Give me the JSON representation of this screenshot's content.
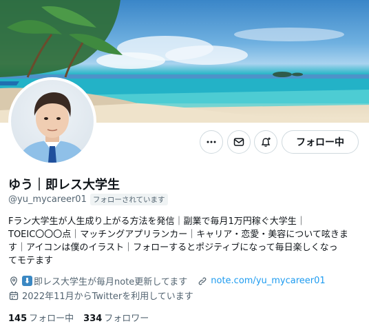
{
  "profile": {
    "display_name": "ゆう｜即レス大学生",
    "handle": "@yu_mycareer01",
    "follows_you_badge": "フォローされています",
    "bio_lines": [
      "Fラン大学生が人生成り上がる方法を発信｜副業で毎月1万円稼ぐ大学生｜",
      "TOEIC〇〇〇点｜マッチングアプリランカー｜キャリア・恋愛・美容について呟きま",
      "す｜アイコンは僕のイラスト｜フォローするとポジティブになって毎日楽しくなっ",
      "てモテます"
    ],
    "location_emoji": "⬇",
    "location_text": "即レス大学生が毎月note更新してます",
    "website": "note.com/yu_mycareer01",
    "joined": "2022年11月からTwitterを利用しています",
    "following_count": "145",
    "following_label": "フォロー中",
    "followers_count": "334",
    "followers_label": "フォロワー"
  },
  "actions": {
    "follow_button": "フォロー中"
  },
  "icons": {
    "more": "more-icon",
    "message": "envelope-icon",
    "notify": "bell-plus-icon",
    "location": "location-pin-icon",
    "link": "link-icon",
    "calendar": "calendar-icon"
  },
  "colors": {
    "link": "#1d9bf0",
    "secondary_text": "#536471",
    "border": "#cfd9de"
  }
}
